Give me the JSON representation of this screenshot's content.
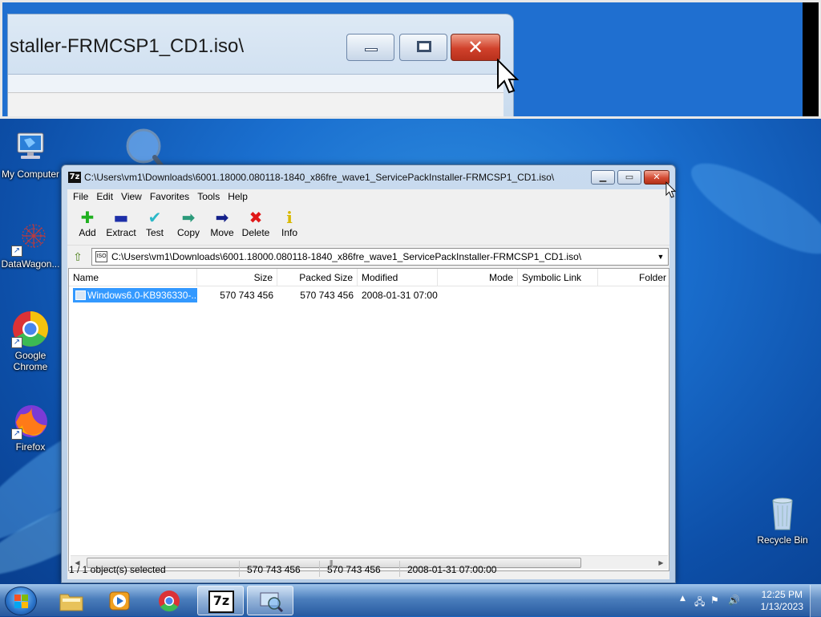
{
  "magnifier": {
    "zoomed_title": "staller-FRMCSP1_CD1.iso\\"
  },
  "desktop": {
    "icons": [
      {
        "label": "My Computer",
        "icon": "computer-icon"
      },
      {
        "label": "DataWagon...",
        "icon": "datawagon-icon"
      },
      {
        "label": "Google Chrome",
        "icon": "chrome-icon"
      },
      {
        "label": "Firefox",
        "icon": "firefox-icon"
      },
      {
        "label": "Recycle Bin",
        "icon": "recycle-bin-icon"
      }
    ]
  },
  "window": {
    "app_icon_text": "7z",
    "title": "C:\\Users\\vm1\\Downloads\\6001.18000.080118-1840_x86fre_wave1_ServicePackInstaller-FRMCSP1_CD1.iso\\",
    "menu": [
      "File",
      "Edit",
      "View",
      "Favorites",
      "Tools",
      "Help"
    ],
    "toolbar": [
      {
        "label": "Add",
        "icon": "plus-icon",
        "glyph": "✚",
        "color": "#1fb01f"
      },
      {
        "label": "Extract",
        "icon": "minus-icon",
        "glyph": "▬",
        "color": "#1d2fa8"
      },
      {
        "label": "Test",
        "icon": "check-icon",
        "glyph": "✔",
        "color": "#2bb8c8"
      },
      {
        "label": "Copy",
        "icon": "copy-arrow-icon",
        "glyph": "➡",
        "color": "#2b9a7a"
      },
      {
        "label": "Move",
        "icon": "move-arrow-icon",
        "glyph": "➡",
        "color": "#14208a"
      },
      {
        "label": "Delete",
        "icon": "delete-x-icon",
        "glyph": "✖",
        "color": "#e01818"
      },
      {
        "label": "Info",
        "icon": "info-icon",
        "glyph": "i",
        "color": "#d8b800"
      }
    ],
    "address": {
      "icon_text": "ISO",
      "path": "C:\\Users\\vm1\\Downloads\\6001.18000.080118-1840_x86fre_wave1_ServicePackInstaller-FRMCSP1_CD1.iso\\"
    },
    "columns": [
      "Name",
      "Size",
      "Packed Size",
      "Modified",
      "Mode",
      "Symbolic Link",
      "Folder"
    ],
    "rows": [
      {
        "name": "Windows6.0-KB936330-...",
        "size": "570 743 456",
        "packed_size": "570 743 456",
        "modified": "2008-01-31 07:00"
      }
    ],
    "status": {
      "selection": "1 / 1 object(s) selected",
      "size": "570 743 456",
      "packed": "570 743 456",
      "modified": "2008-01-31 07:00:00"
    }
  },
  "taskbar": {
    "items": [
      {
        "name": "explorer",
        "icon": "folder-icon"
      },
      {
        "name": "media-player",
        "icon": "media-player-icon"
      },
      {
        "name": "chrome",
        "icon": "chrome-icon"
      },
      {
        "name": "7zip",
        "icon": "7zip-icon",
        "text": "7z"
      },
      {
        "name": "magnifier",
        "icon": "magnifier-icon"
      }
    ],
    "clock": {
      "time": "12:25 PM",
      "date": "1/13/2023"
    }
  },
  "colors": {
    "selection": "#3399ff",
    "close_button": "#d34a33",
    "desktop": "#1a6fcf"
  }
}
